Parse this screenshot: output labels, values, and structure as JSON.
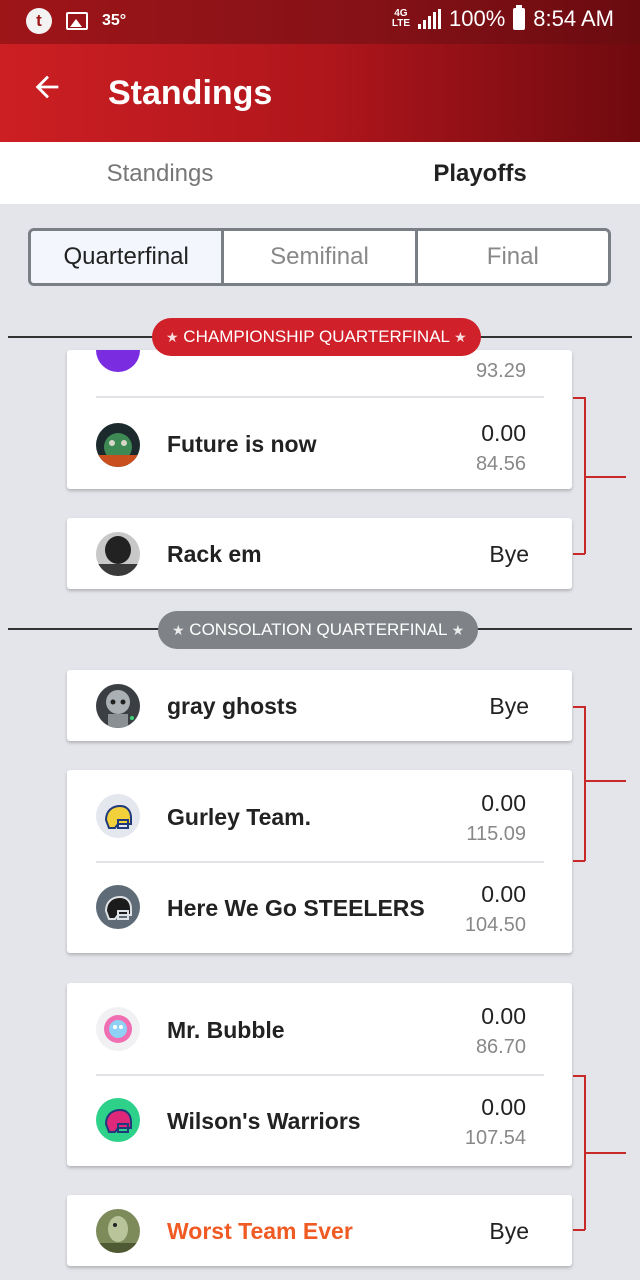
{
  "status_bar": {
    "temperature": "35°",
    "network": "4G LTE",
    "battery": "100%",
    "time": "8:54 AM",
    "app_icon": "t"
  },
  "header": {
    "title": "Standings"
  },
  "top_tabs": [
    {
      "label": "Standings",
      "active": false
    },
    {
      "label": "Playoffs",
      "active": true
    }
  ],
  "rounds": [
    {
      "label": "Quarterfinal",
      "active": true
    },
    {
      "label": "Semifinal",
      "active": false
    },
    {
      "label": "Final",
      "active": false
    }
  ],
  "sections": {
    "championship": "CHAMPIONSHIP QUARTERFINAL",
    "consolation": "CONSOLATION QUARTERFINAL"
  },
  "teams": {
    "cut_top": {
      "projected": "93.29"
    },
    "future": {
      "name": "Future is now",
      "score": "0.00",
      "projected": "84.56"
    },
    "rack": {
      "name": "Rack em",
      "status": "Bye"
    },
    "gray": {
      "name": "gray ghosts",
      "status": "Bye"
    },
    "gurley": {
      "name": "Gurley Team.",
      "score": "0.00",
      "projected": "115.09"
    },
    "steelers": {
      "name": "Here We Go  STEELERS",
      "score": "0.00",
      "projected": "104.50"
    },
    "bubble": {
      "name": "Mr. Bubble",
      "score": "0.00",
      "projected": "86.70"
    },
    "wilson": {
      "name": "Wilson's Warriors",
      "score": "0.00",
      "projected": "107.54"
    },
    "worst": {
      "name": "Worst Team Ever",
      "status": "Bye"
    }
  },
  "colors": {
    "brand_red": "#c8202a",
    "highlight_orange": "#f05a23",
    "bracket_line": "#c82a2a"
  }
}
